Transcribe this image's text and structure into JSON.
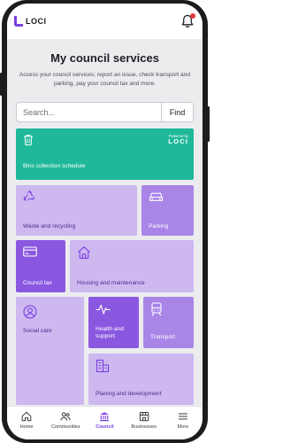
{
  "app": {
    "brand": "LOCI"
  },
  "page": {
    "title": "My council services",
    "subtitle": "Access your council services; report an issue, check transport and parking, pay your council tax and more."
  },
  "search": {
    "placeholder": "Search...",
    "button_label": "Find"
  },
  "tiles": {
    "bins": {
      "label": "Bins collection schedule",
      "badge_top": "Powered by",
      "badge_brand": "LOCI"
    },
    "waste": {
      "label": "Waste and recycling"
    },
    "parking": {
      "label": "Parking"
    },
    "council_tax": {
      "label": "Council tax"
    },
    "housing": {
      "label": "Housing and maintenance"
    },
    "social_care": {
      "label": "Social care"
    },
    "health": {
      "label": "Health and support"
    },
    "transport": {
      "label": "Transport"
    },
    "planning": {
      "label": "Planing and development"
    }
  },
  "nav": {
    "items": [
      {
        "label": "Home",
        "icon": "home-icon"
      },
      {
        "label": "Communities",
        "icon": "people-icon"
      },
      {
        "label": "Council",
        "icon": "council-icon",
        "active": true
      },
      {
        "label": "Businesses",
        "icon": "store-icon"
      },
      {
        "label": "More",
        "icon": "menu-icon"
      }
    ]
  },
  "colors": {
    "accent": "#7b3fe4",
    "teal": "#1fb89a",
    "lavender": "#cdb8f0",
    "purple_mid": "#a985e8",
    "purple_dark": "#8a58e0"
  }
}
